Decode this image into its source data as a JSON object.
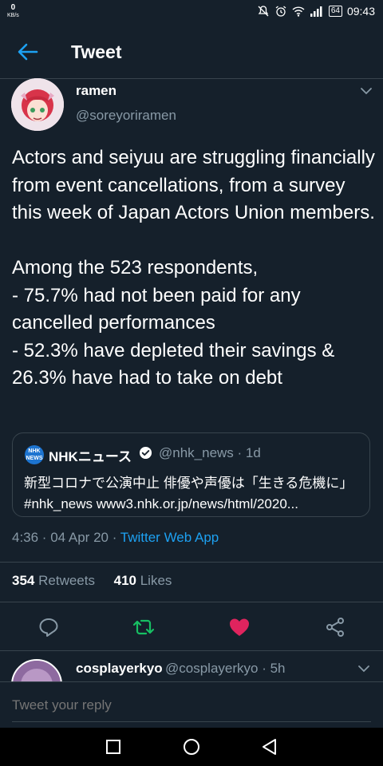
{
  "status_bar": {
    "network_speed": "0",
    "network_unit": "KB/s",
    "battery": "64",
    "time": "09:43"
  },
  "header": {
    "title": "Tweet"
  },
  "tweet": {
    "author_name": "ramen",
    "author_handle": "@soreyoriramen",
    "text": "Actors and seiyuu are struggling financially from event cancellations, from a survey this week of Japan Actors Union members.\n\nAmong the 523 respondents,\n- 75.7% had not been paid for any cancelled performances\n- 52.3% have depleted their savings & 26.3% have had to take on debt",
    "quote": {
      "logo_text": "NHK NEWS",
      "name": "NHKニュース",
      "handle_time": "@nhk_news · 1d",
      "text": "新型コロナで公演中止 俳優や声優は「生きる危機に」#nhk_news www3.nhk.or.jp/news/html/2020..."
    },
    "timestamp": "4:36 · 04 Apr 20 · ",
    "source_app": "Twitter Web App",
    "retweets_count": "354",
    "retweets_label": "Retweets",
    "likes_count": "410",
    "likes_label": "Likes"
  },
  "reply": {
    "author_name": "cosplayerkyo",
    "author_handle_time": "@cosplayerkyo · 5h"
  },
  "compose": {
    "placeholder": "Tweet your reply"
  },
  "colors": {
    "background": "#15202b",
    "accent": "#1da1f2",
    "secondary_text": "#8899a6",
    "retweet_green": "#17bf63",
    "like_pink": "#e0245e"
  }
}
